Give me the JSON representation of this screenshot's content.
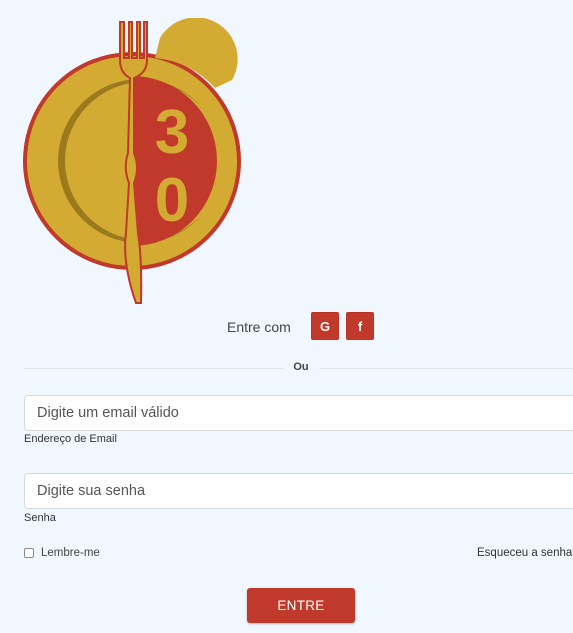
{
  "brand": {
    "logo_icon": "plate-fork-knife-30-logo",
    "logo_text": "30",
    "colors": {
      "red": "#c0392b",
      "gold": "#d4ab32"
    }
  },
  "social": {
    "label": "Entre com",
    "google_glyph": "G",
    "facebook_glyph": "f"
  },
  "divider": {
    "text": "Ou"
  },
  "form": {
    "email": {
      "placeholder": "Digite um email válido",
      "label": "Endereço de Email"
    },
    "password": {
      "placeholder": "Digite sua senha",
      "label": "Senha"
    },
    "remember_label": "Lembre-me",
    "forgot_label": "Esqueceu a senha?",
    "submit_label": "ENTRE"
  }
}
